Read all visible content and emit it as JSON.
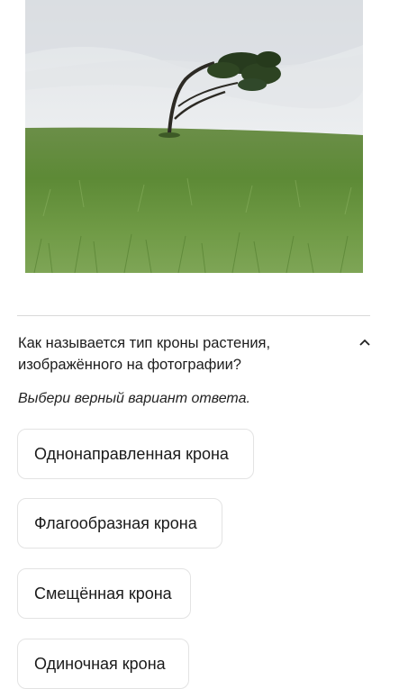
{
  "question": {
    "text": "Как называется тип кроны растения, изображённого на фотографии?",
    "hint": "Выбери верный вариант ответа."
  },
  "answer_options": [
    {
      "label": "Однонаправленная крона"
    },
    {
      "label": "Флагообразная крона"
    },
    {
      "label": "Смещённая крона"
    },
    {
      "label": "Одиночная крона"
    }
  ],
  "icons": {
    "collapse": "chevron-up-icon"
  },
  "colors": {
    "sky": "#e6e9ec",
    "grass": "#5f8a3c",
    "border": "#e3e3e3",
    "divider": "#d9d9d9"
  }
}
